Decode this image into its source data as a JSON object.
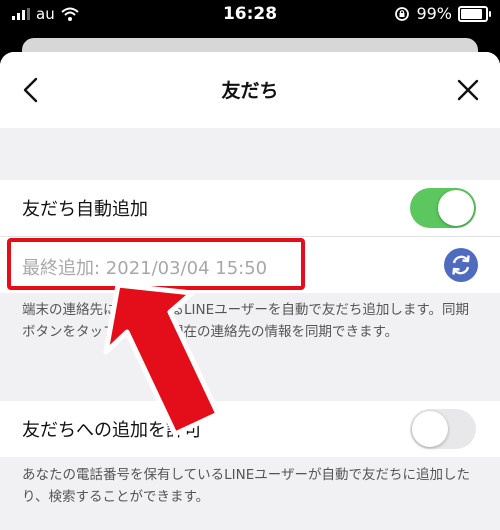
{
  "status_bar": {
    "carrier": "au",
    "time": "16:28",
    "battery_percent": "99%"
  },
  "header": {
    "title": "友だち",
    "back_icon": "chevron-left-icon",
    "close_icon": "close-icon"
  },
  "settings": {
    "auto_add": {
      "label": "友だち自動追加",
      "enabled": true,
      "last_added": "最終追加: 2021/03/04 15:50",
      "description": "端末の連絡先に保存されるLINEユーザーを自動で友だち追加します。同期ボタンをタップすると、現在の連絡先の情報を同期できます。"
    },
    "allow_add": {
      "label": "友だちへの追加を許可",
      "enabled": false,
      "description": "あなたの電話番号を保有しているLINEユーザーが自動で友だちに追加したり、検索することができます。"
    }
  },
  "colors": {
    "toggle_on": "#5bc75e",
    "toggle_off": "#e8e8ea",
    "highlight": "#e40e1a",
    "sync_button": "#4f6bbd"
  }
}
